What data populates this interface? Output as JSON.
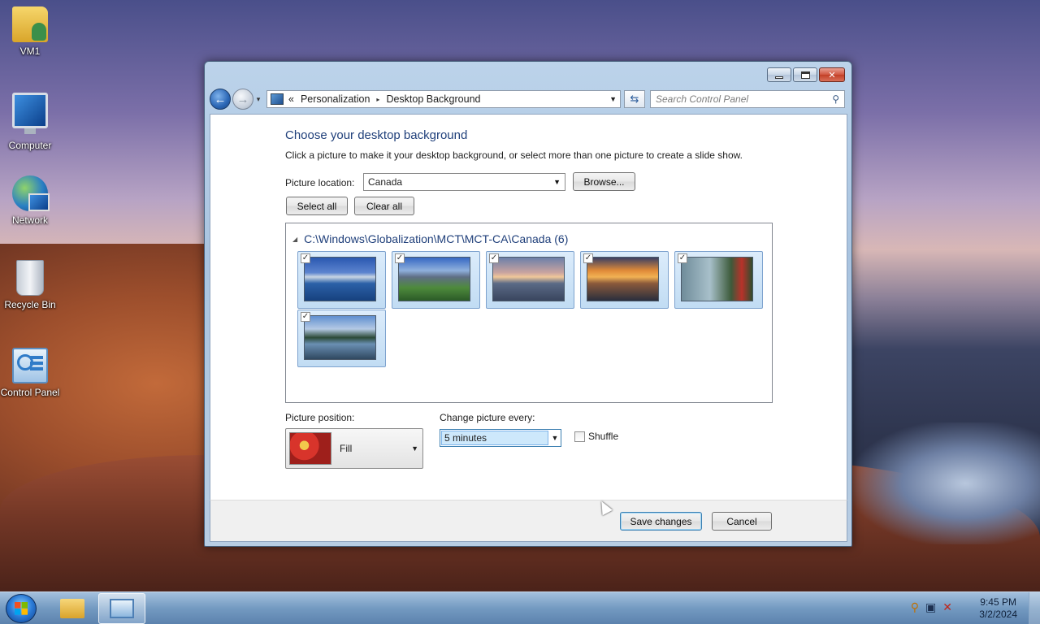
{
  "desktop": {
    "icons": [
      {
        "label": "VM1",
        "icon": "user-folder-icon"
      },
      {
        "label": "Computer",
        "icon": "computer-icon"
      },
      {
        "label": "Network",
        "icon": "network-icon"
      },
      {
        "label": "Recycle Bin",
        "icon": "recycle-bin-icon"
      },
      {
        "label": "Control Panel",
        "icon": "control-panel-icon"
      }
    ]
  },
  "window": {
    "controls": {
      "minimize": "minimize-icon",
      "maximize": "maximize-icon",
      "close": "✕"
    },
    "nav": {
      "back_glyph": "←",
      "forward_glyph": "→",
      "history_glyph": "▾",
      "breadcrumb_prefix": "«",
      "breadcrumb": [
        "Personalization",
        "Desktop Background"
      ],
      "breadcrumb_sep": "▸",
      "dropdown_glyph": "▼",
      "refresh_glyph": "⇆",
      "search_placeholder": "Search Control Panel",
      "search_glyph": "⚲"
    },
    "content": {
      "title": "Choose your desktop background",
      "description": "Click a picture to make it your desktop background, or select more than one picture to create a slide show.",
      "picture_location_label": "Picture location:",
      "picture_location_value": "Canada",
      "browse_label": "Browse...",
      "select_all_label": "Select all",
      "clear_all_label": "Clear all",
      "group_toggle_glyph": "◢",
      "group_title": "C:\\Windows\\Globalization\\MCT\\MCT-CA\\Canada (6)",
      "check_glyph": "✓",
      "thumbnails": [
        {
          "name": "mountain-lake-thumbnail",
          "checked": true
        },
        {
          "name": "mountain-creek-thumbnail",
          "checked": true
        },
        {
          "name": "lighthouse-thumbnail",
          "checked": true
        },
        {
          "name": "sunset-lake-thumbnail",
          "checked": true
        },
        {
          "name": "canoe-lake-thumbnail",
          "checked": true
        },
        {
          "name": "island-lake-thumbnail",
          "checked": true
        }
      ],
      "picture_position_label": "Picture position:",
      "picture_position_value": "Fill",
      "change_every_label": "Change picture every:",
      "change_every_value": "5 minutes",
      "shuffle_label": "Shuffle",
      "shuffle_checked": false,
      "combo_arrow": "▼"
    },
    "footer": {
      "save_label": "Save changes",
      "cancel_label": "Cancel"
    }
  },
  "taskbar": {
    "pinned": [
      "windows-explorer-icon",
      "control-panel-icon"
    ],
    "tray_icons": [
      "action-center-icon",
      "network-tray-icon",
      "volume-muted-icon"
    ],
    "tray_glyphs": [
      "⚲",
      "▣",
      "✕"
    ],
    "time": "9:45 PM",
    "date": "3/2/2024"
  }
}
